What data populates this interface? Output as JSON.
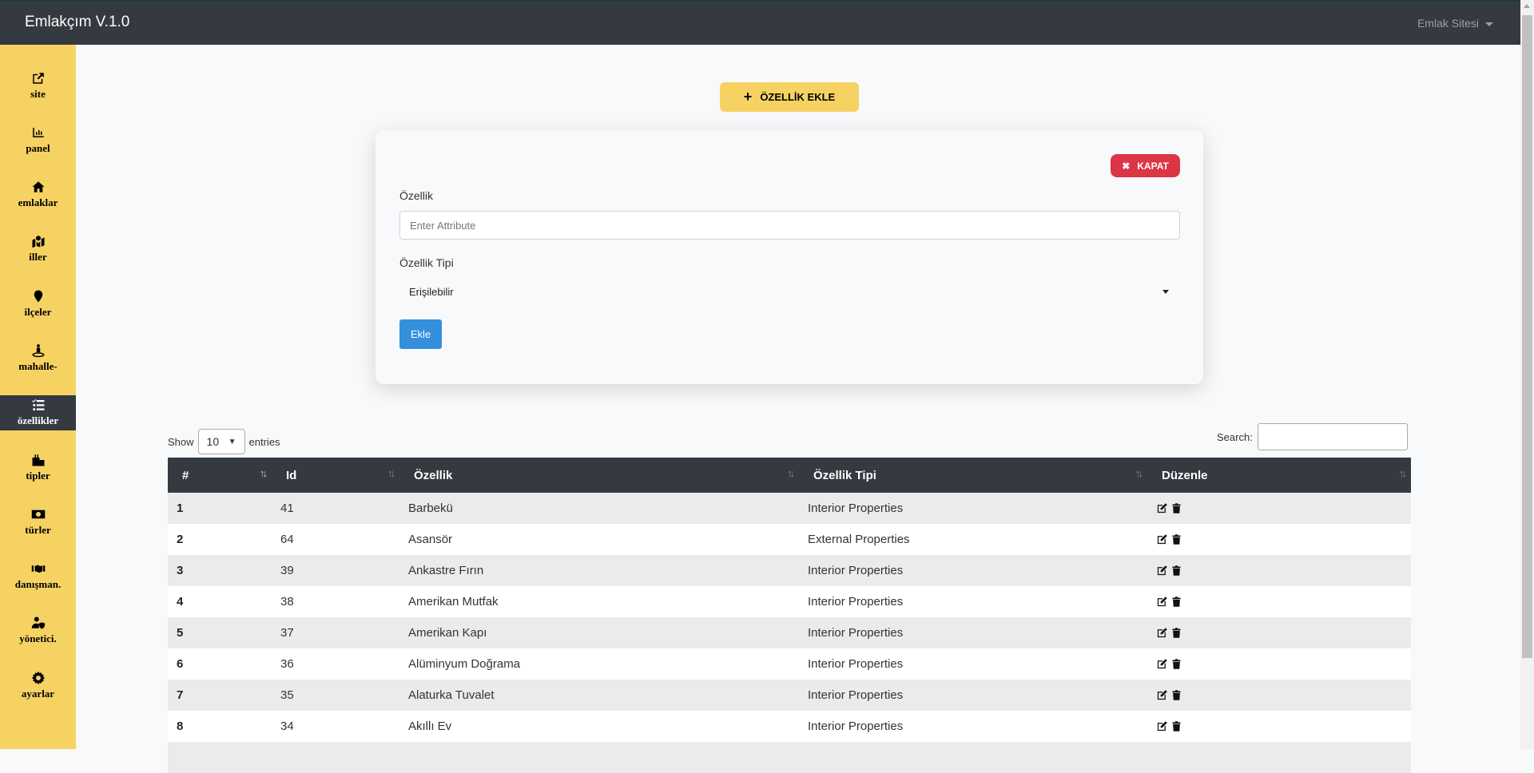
{
  "navbar": {
    "brand": "Emlakçım V.1.0",
    "dropdown": "Emlak Sitesi"
  },
  "sidebar": {
    "items": [
      {
        "label": "site",
        "icon": "external-link-icon"
      },
      {
        "label": "panel",
        "icon": "chart-bar-icon"
      },
      {
        "label": "emlaklar",
        "icon": "home-icon"
      },
      {
        "label": "iller",
        "icon": "map-marked-icon"
      },
      {
        "label": "ilçeler",
        "icon": "map-marker-icon"
      },
      {
        "label": "mahalle-",
        "icon": "street-view-icon"
      },
      {
        "label": "özellikler",
        "icon": "tasks-icon",
        "active": true
      },
      {
        "label": "tipler",
        "icon": "city-icon"
      },
      {
        "label": "türler",
        "icon": "money-bill-icon"
      },
      {
        "label": "danışman.",
        "icon": "handshake-icon"
      },
      {
        "label": "yönetici.",
        "icon": "user-shield-icon"
      },
      {
        "label": "ayarlar",
        "icon": "cog-icon"
      }
    ]
  },
  "add_button": "ÖZELLİK EKLE",
  "form": {
    "close_button": "KAPAT",
    "attribute_label": "Özellik",
    "attribute_placeholder": "Enter Attribute",
    "type_label": "Özellik Tipi",
    "type_value": "Erişilebilir",
    "submit": "Ekle"
  },
  "table_controls": {
    "show": "Show",
    "length": "10",
    "entries": "entries",
    "search": "Search:"
  },
  "table": {
    "columns": [
      "#",
      "Id",
      "Özellik",
      "Özellik Tipi",
      "Düzenle"
    ],
    "rows": [
      [
        "1",
        "41",
        "Barbekü",
        "Interior Properties"
      ],
      [
        "2",
        "64",
        "Asansör",
        "External Properties"
      ],
      [
        "3",
        "39",
        "Ankastre Fırın",
        "Interior Properties"
      ],
      [
        "4",
        "38",
        "Amerikan Mutfak",
        "Interior Properties"
      ],
      [
        "5",
        "37",
        "Amerikan Kapı",
        "Interior Properties"
      ],
      [
        "6",
        "36",
        "Alüminyum Doğrama",
        "Interior Properties"
      ],
      [
        "7",
        "35",
        "Alaturka Tuvalet",
        "Interior Properties"
      ],
      [
        "8",
        "34",
        "Akıllı Ev",
        "Interior Properties"
      ],
      [
        "",
        "",
        "",
        ""
      ]
    ]
  }
}
